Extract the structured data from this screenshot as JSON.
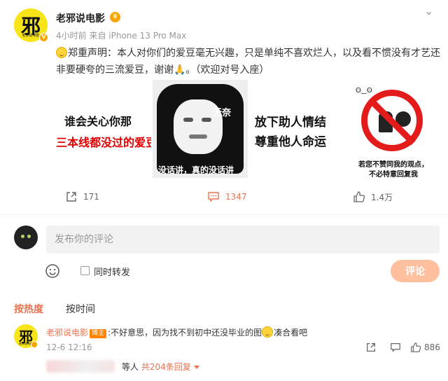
{
  "post": {
    "author": "老邪说电影",
    "avatar_glyph": "邪",
    "avatar_sub": "老邪说电影",
    "time": "4小时前",
    "source": "来自 iPhone 13 Pro Max",
    "text": "郑重声明：本人对你们的爱豆毫无兴趣，只是单纯不喜欢烂人，以及看不惯没有才艺还非要硬夸的三流爱豆，谢谢🙏。（欢迎对号入座）",
    "images": [
      {
        "line1": "谁会关心你那",
        "line2": "三本线都没过的爱豆啊"
      },
      {
        "top": "无奈",
        "caption": "没话讲，真的没话讲"
      },
      {
        "line1": "放下助人情结",
        "line2": "尊重他人命运"
      },
      {
        "ghosts": "ʘ‿ʘ",
        "line1": "若您不赞同我的观点，",
        "line2": "不必特意回复我"
      }
    ],
    "actions": {
      "share": "171",
      "comments": "1347",
      "likes": "1.4万"
    }
  },
  "composer": {
    "placeholder": "发布你的评论",
    "repost_label": "同时转发",
    "submit": "评论"
  },
  "sort": {
    "hot": "按热度",
    "time": "按时间"
  },
  "comment": {
    "avatar_glyph": "邪",
    "avatar_sub": "老邪说电影",
    "author": "老邪说电影",
    "badge": "博主",
    "text_before": ":不好意思，因为找不到初中还没毕业的图",
    "text_after": "凑合看吧",
    "time": "12-6 12:16",
    "likes": "886",
    "replies_prefix": "等人",
    "replies_count": "共204条回复"
  },
  "colors": {
    "accent": "#eb7350",
    "brand_yellow": "#f7e51a",
    "vip_orange": "#f7a600"
  }
}
